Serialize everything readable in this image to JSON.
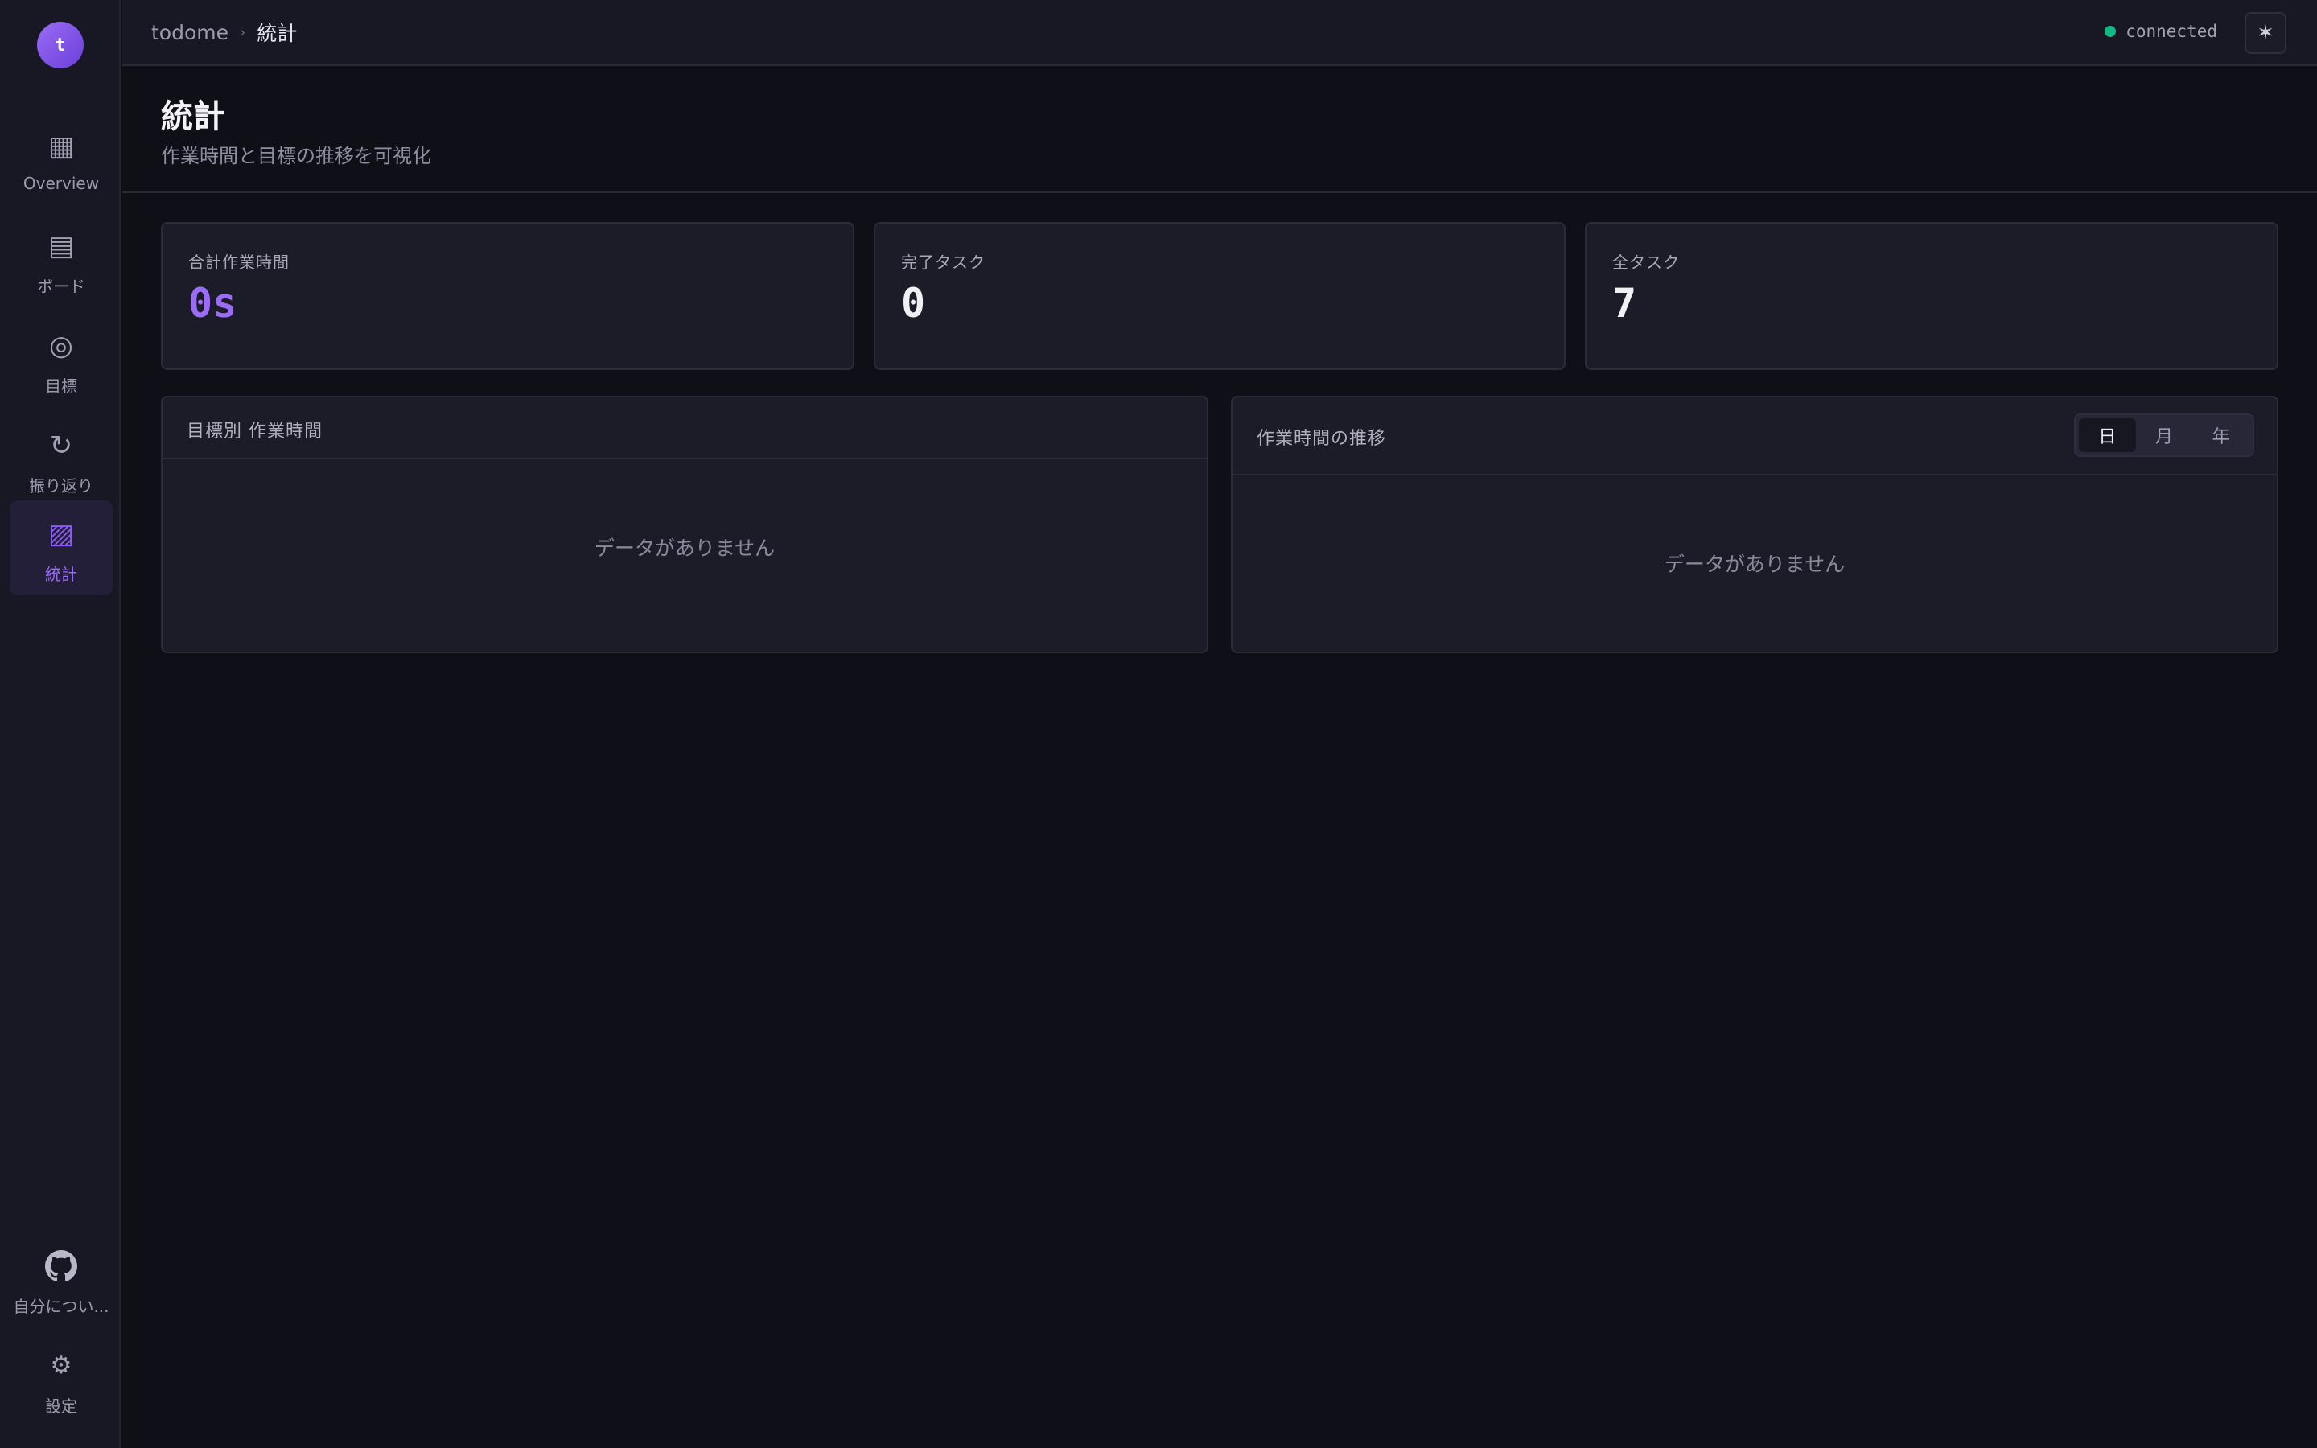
{
  "sidebar": {
    "avatar_initial": "t",
    "items": [
      {
        "label": "Overview",
        "icon": "grid-icon"
      },
      {
        "label": "ボード",
        "icon": "board-icon"
      },
      {
        "label": "目標",
        "icon": "target-icon"
      },
      {
        "label": "振り返り",
        "icon": "refresh-icon"
      },
      {
        "label": "統計",
        "icon": "stats-icon",
        "active": true
      }
    ],
    "bottom": [
      {
        "label": "自分につい...",
        "icon": "github-icon"
      },
      {
        "label": "設定",
        "icon": "gear-icon"
      }
    ]
  },
  "topbar": {
    "breadcrumb_root": "todome",
    "breadcrumb_current": "統計",
    "status_text": "connected",
    "status_color": "#10b981",
    "theme_icon": "sun-icon"
  },
  "header": {
    "title": "統計",
    "subtitle": "作業時間と目標の推移を可視化"
  },
  "stats": [
    {
      "label": "合計作業時間",
      "value": "0s",
      "accent": "#9b6cf7"
    },
    {
      "label": "完了タスク",
      "value": "0"
    },
    {
      "label": "全タスク",
      "value": "7"
    }
  ],
  "panels": {
    "by_goal": {
      "title": "目標別 作業時間",
      "empty": "データがありません"
    },
    "trend": {
      "title": "作業時間の推移",
      "empty": "データがありません",
      "ranges": [
        "日",
        "月",
        "年"
      ],
      "selected_range": "日"
    }
  },
  "colors": {
    "accent": "#8b5cf6",
    "background": "#0f0f17",
    "surface": "#1c1c28"
  }
}
